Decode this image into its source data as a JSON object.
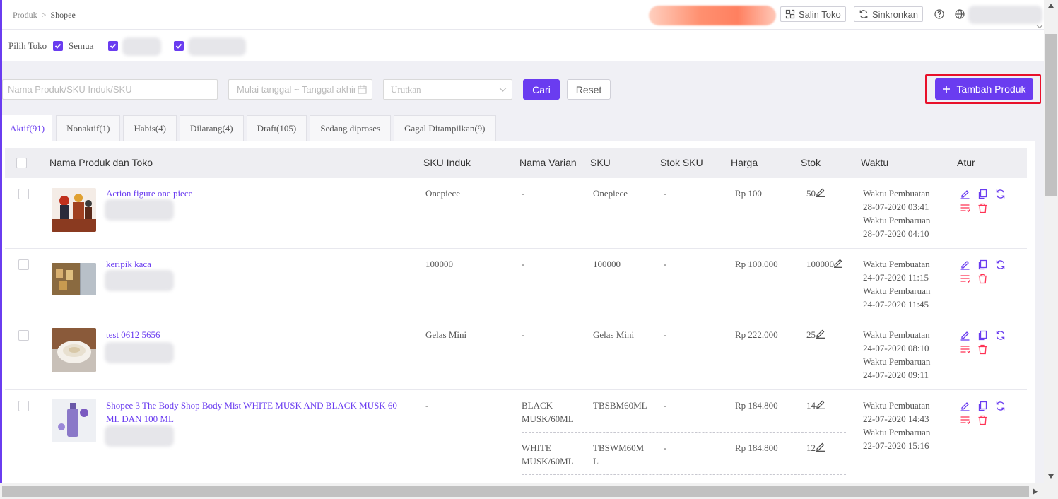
{
  "breadcrumb": {
    "root": "Produk",
    "separator": ">",
    "current": "Shopee"
  },
  "toolbar": {
    "copy_store": "Salin Toko",
    "sync": "Sinkronkan"
  },
  "stores": {
    "label": "Pilih Toko",
    "all": "Semua"
  },
  "search": {
    "name_placeholder": "Nama Produk/SKU Induk/SKU",
    "date_placeholder": "Mulai tanggal ~ Tanggal akhir",
    "sort_placeholder": "Urutkan",
    "search_button": "Cari",
    "reset_button": "Reset",
    "add_button": "Tambah Produk"
  },
  "tabs": [
    {
      "label": "Aktif(91)"
    },
    {
      "label": "Nonaktif(1)"
    },
    {
      "label": "Habis(4)"
    },
    {
      "label": "Dilarang(4)"
    },
    {
      "label": "Draft(105)"
    },
    {
      "label": "Sedang diproses"
    },
    {
      "label": "Gagal Ditampilkan(9)"
    }
  ],
  "table": {
    "headers": {
      "product": "Nama Produk dan Toko",
      "sku_parent": "SKU Induk",
      "variant": "Nama Varian",
      "sku": "SKU",
      "stock_sku": "Stok SKU",
      "price": "Harga",
      "stock": "Stok",
      "time": "Waktu",
      "actions": "Atur"
    },
    "rows": [
      {
        "name": "Action figure one piece",
        "sku_parent": "Onepiece",
        "variants": [
          {
            "variant": "-",
            "sku": "Onepiece",
            "stock_sku": "-",
            "price": "Rp 100",
            "stock": "50"
          }
        ],
        "created_label": "Waktu Pembuatan",
        "created": "28-07-2020 03:41",
        "updated_label": "Waktu Pembaruan",
        "updated": "28-07-2020 04:10"
      },
      {
        "name": "keripik kaca",
        "sku_parent": "100000",
        "variants": [
          {
            "variant": "-",
            "sku": "100000",
            "stock_sku": "-",
            "price": "Rp 100.000",
            "stock": "100000"
          }
        ],
        "created_label": "Waktu Pembuatan",
        "created": "24-07-2020 11:15",
        "updated_label": "Waktu Pembaruan",
        "updated": "24-07-2020 11:45"
      },
      {
        "name": "test 0612 5656",
        "sku_parent": "Gelas Mini",
        "variants": [
          {
            "variant": "-",
            "sku": "Gelas Mini",
            "stock_sku": "-",
            "price": "Rp 222.000",
            "stock": "25"
          }
        ],
        "created_label": "Waktu Pembuatan",
        "created": "24-07-2020 08:10",
        "updated_label": "Waktu Pembaruan",
        "updated": "24-07-2020 09:11"
      },
      {
        "name_line1": "Shopee 3 The Body Shop Body Mist WHITE MUSK AND BLACK MUSK 60",
        "name_line2": "ML DAN 100 ML",
        "sku_parent": "-",
        "variants": [
          {
            "variant_line1": "BLACK",
            "variant_line2": "MUSK/60ML",
            "sku": "TBSBM60ML",
            "stock_sku": "-",
            "price": "Rp 184.800",
            "stock": "14"
          },
          {
            "variant_line1": "WHITE",
            "variant_line2": "MUSK/60ML",
            "sku_line1": "TBSWM60M",
            "sku_line2": "L",
            "stock_sku": "-",
            "price": "Rp 184.800",
            "stock": "12"
          }
        ],
        "created_label": "Waktu Pembuatan",
        "created": "22-07-2020 14:43",
        "updated_label": "Waktu Pembaruan",
        "updated": "22-07-2020 15:16"
      }
    ]
  },
  "colors": {
    "accent": "#6a3cf0",
    "danger": "#e8102a",
    "delete_icon": "#ff3355"
  }
}
